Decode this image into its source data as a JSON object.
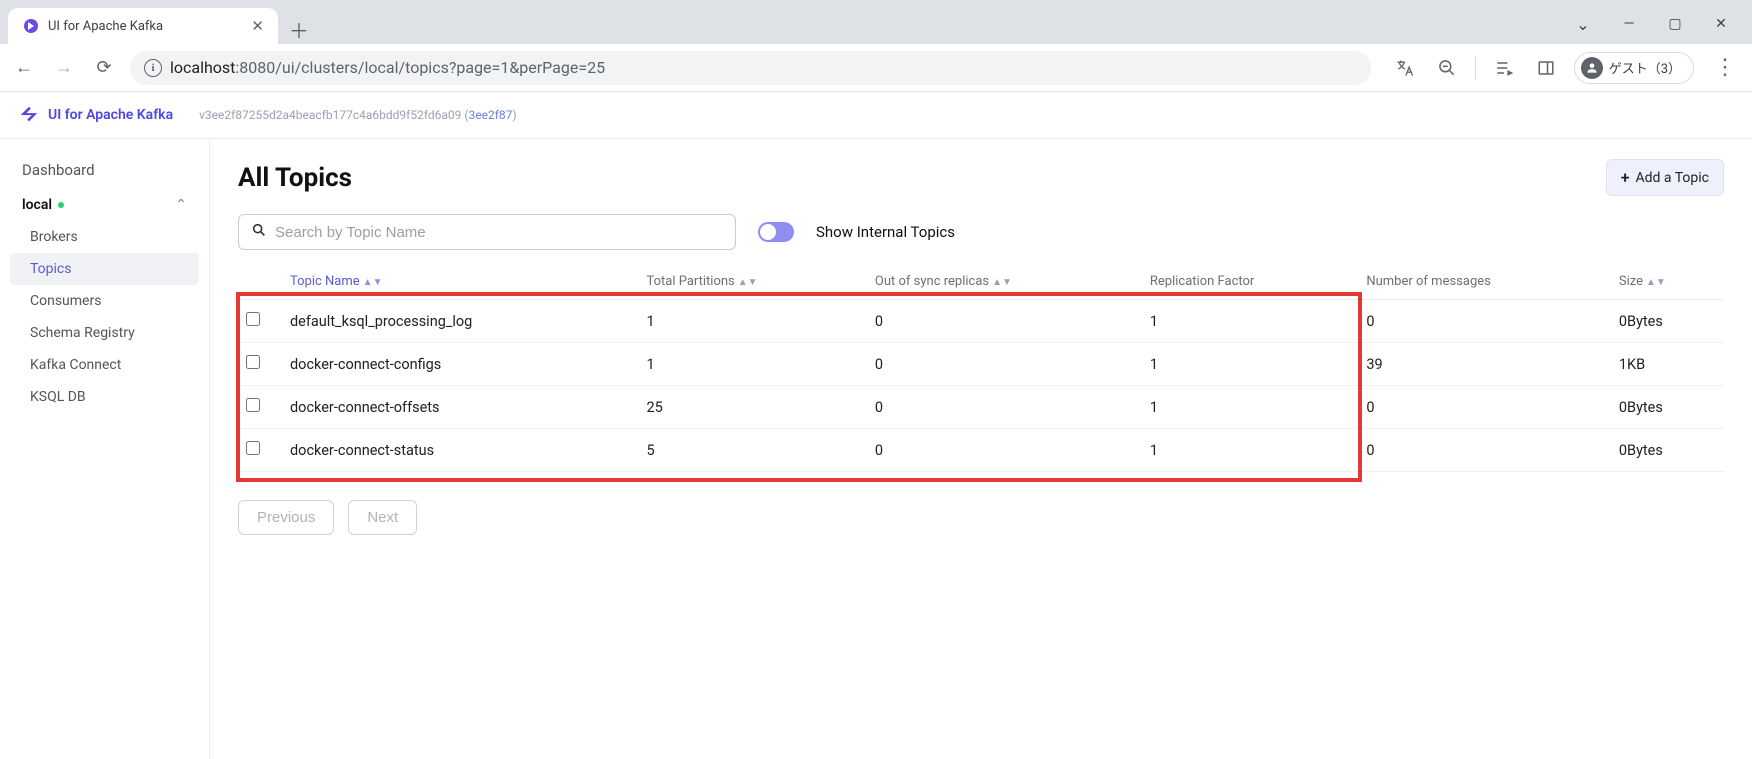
{
  "browser": {
    "tab_title": "UI for Apache Kafka",
    "url_host": "localhost",
    "url_port_path": ":8080/ui/clusters/local/topics?page=1&perPage=25",
    "guest_label": "ゲスト（3）"
  },
  "app": {
    "name": "UI for Apache Kafka",
    "version_long": "v3ee2f87255d2a4beacfb177c4a6bdd9f52fd6a09",
    "version_short": "3ee2f87"
  },
  "sidebar": {
    "dashboard": "Dashboard",
    "cluster": "local",
    "items": [
      "Brokers",
      "Topics",
      "Consumers",
      "Schema Registry",
      "Kafka Connect",
      "KSQL DB"
    ],
    "active_index": 1
  },
  "page": {
    "title": "All Topics",
    "add_button": "Add a Topic",
    "search_placeholder": "Search by Topic Name",
    "toggle_label": "Show Internal Topics"
  },
  "table": {
    "headers": {
      "topic": "Topic Name",
      "partitions": "Total Partitions",
      "out_of_sync": "Out of sync replicas",
      "replication": "Replication Factor",
      "messages": "Number of messages",
      "size": "Size"
    },
    "rows": [
      {
        "name": "default_ksql_processing_log",
        "partitions": "1",
        "out_of_sync": "0",
        "replication": "1",
        "messages": "0",
        "size": "0Bytes"
      },
      {
        "name": "docker-connect-configs",
        "partitions": "1",
        "out_of_sync": "0",
        "replication": "1",
        "messages": "39",
        "size": "1KB"
      },
      {
        "name": "docker-connect-offsets",
        "partitions": "25",
        "out_of_sync": "0",
        "replication": "1",
        "messages": "0",
        "size": "0Bytes"
      },
      {
        "name": "docker-connect-status",
        "partitions": "5",
        "out_of_sync": "0",
        "replication": "1",
        "messages": "0",
        "size": "0Bytes"
      }
    ]
  },
  "pager": {
    "prev": "Previous",
    "next": "Next"
  }
}
